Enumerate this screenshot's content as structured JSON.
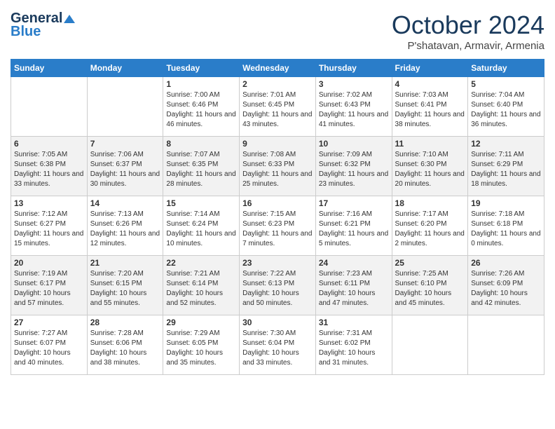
{
  "header": {
    "logo_general": "General",
    "logo_blue": "Blue",
    "title": "October 2024",
    "location": "P'shatavan, Armavir, Armenia"
  },
  "days_of_week": [
    "Sunday",
    "Monday",
    "Tuesday",
    "Wednesday",
    "Thursday",
    "Friday",
    "Saturday"
  ],
  "weeks": [
    [
      {
        "day": "",
        "sunrise": "",
        "sunset": "",
        "daylight": ""
      },
      {
        "day": "",
        "sunrise": "",
        "sunset": "",
        "daylight": ""
      },
      {
        "day": "1",
        "sunrise": "Sunrise: 7:00 AM",
        "sunset": "Sunset: 6:46 PM",
        "daylight": "Daylight: 11 hours and 46 minutes."
      },
      {
        "day": "2",
        "sunrise": "Sunrise: 7:01 AM",
        "sunset": "Sunset: 6:45 PM",
        "daylight": "Daylight: 11 hours and 43 minutes."
      },
      {
        "day": "3",
        "sunrise": "Sunrise: 7:02 AM",
        "sunset": "Sunset: 6:43 PM",
        "daylight": "Daylight: 11 hours and 41 minutes."
      },
      {
        "day": "4",
        "sunrise": "Sunrise: 7:03 AM",
        "sunset": "Sunset: 6:41 PM",
        "daylight": "Daylight: 11 hours and 38 minutes."
      },
      {
        "day": "5",
        "sunrise": "Sunrise: 7:04 AM",
        "sunset": "Sunset: 6:40 PM",
        "daylight": "Daylight: 11 hours and 36 minutes."
      }
    ],
    [
      {
        "day": "6",
        "sunrise": "Sunrise: 7:05 AM",
        "sunset": "Sunset: 6:38 PM",
        "daylight": "Daylight: 11 hours and 33 minutes."
      },
      {
        "day": "7",
        "sunrise": "Sunrise: 7:06 AM",
        "sunset": "Sunset: 6:37 PM",
        "daylight": "Daylight: 11 hours and 30 minutes."
      },
      {
        "day": "8",
        "sunrise": "Sunrise: 7:07 AM",
        "sunset": "Sunset: 6:35 PM",
        "daylight": "Daylight: 11 hours and 28 minutes."
      },
      {
        "day": "9",
        "sunrise": "Sunrise: 7:08 AM",
        "sunset": "Sunset: 6:33 PM",
        "daylight": "Daylight: 11 hours and 25 minutes."
      },
      {
        "day": "10",
        "sunrise": "Sunrise: 7:09 AM",
        "sunset": "Sunset: 6:32 PM",
        "daylight": "Daylight: 11 hours and 23 minutes."
      },
      {
        "day": "11",
        "sunrise": "Sunrise: 7:10 AM",
        "sunset": "Sunset: 6:30 PM",
        "daylight": "Daylight: 11 hours and 20 minutes."
      },
      {
        "day": "12",
        "sunrise": "Sunrise: 7:11 AM",
        "sunset": "Sunset: 6:29 PM",
        "daylight": "Daylight: 11 hours and 18 minutes."
      }
    ],
    [
      {
        "day": "13",
        "sunrise": "Sunrise: 7:12 AM",
        "sunset": "Sunset: 6:27 PM",
        "daylight": "Daylight: 11 hours and 15 minutes."
      },
      {
        "day": "14",
        "sunrise": "Sunrise: 7:13 AM",
        "sunset": "Sunset: 6:26 PM",
        "daylight": "Daylight: 11 hours and 12 minutes."
      },
      {
        "day": "15",
        "sunrise": "Sunrise: 7:14 AM",
        "sunset": "Sunset: 6:24 PM",
        "daylight": "Daylight: 11 hours and 10 minutes."
      },
      {
        "day": "16",
        "sunrise": "Sunrise: 7:15 AM",
        "sunset": "Sunset: 6:23 PM",
        "daylight": "Daylight: 11 hours and 7 minutes."
      },
      {
        "day": "17",
        "sunrise": "Sunrise: 7:16 AM",
        "sunset": "Sunset: 6:21 PM",
        "daylight": "Daylight: 11 hours and 5 minutes."
      },
      {
        "day": "18",
        "sunrise": "Sunrise: 7:17 AM",
        "sunset": "Sunset: 6:20 PM",
        "daylight": "Daylight: 11 hours and 2 minutes."
      },
      {
        "day": "19",
        "sunrise": "Sunrise: 7:18 AM",
        "sunset": "Sunset: 6:18 PM",
        "daylight": "Daylight: 11 hours and 0 minutes."
      }
    ],
    [
      {
        "day": "20",
        "sunrise": "Sunrise: 7:19 AM",
        "sunset": "Sunset: 6:17 PM",
        "daylight": "Daylight: 10 hours and 57 minutes."
      },
      {
        "day": "21",
        "sunrise": "Sunrise: 7:20 AM",
        "sunset": "Sunset: 6:15 PM",
        "daylight": "Daylight: 10 hours and 55 minutes."
      },
      {
        "day": "22",
        "sunrise": "Sunrise: 7:21 AM",
        "sunset": "Sunset: 6:14 PM",
        "daylight": "Daylight: 10 hours and 52 minutes."
      },
      {
        "day": "23",
        "sunrise": "Sunrise: 7:22 AM",
        "sunset": "Sunset: 6:13 PM",
        "daylight": "Daylight: 10 hours and 50 minutes."
      },
      {
        "day": "24",
        "sunrise": "Sunrise: 7:23 AM",
        "sunset": "Sunset: 6:11 PM",
        "daylight": "Daylight: 10 hours and 47 minutes."
      },
      {
        "day": "25",
        "sunrise": "Sunrise: 7:25 AM",
        "sunset": "Sunset: 6:10 PM",
        "daylight": "Daylight: 10 hours and 45 minutes."
      },
      {
        "day": "26",
        "sunrise": "Sunrise: 7:26 AM",
        "sunset": "Sunset: 6:09 PM",
        "daylight": "Daylight: 10 hours and 42 minutes."
      }
    ],
    [
      {
        "day": "27",
        "sunrise": "Sunrise: 7:27 AM",
        "sunset": "Sunset: 6:07 PM",
        "daylight": "Daylight: 10 hours and 40 minutes."
      },
      {
        "day": "28",
        "sunrise": "Sunrise: 7:28 AM",
        "sunset": "Sunset: 6:06 PM",
        "daylight": "Daylight: 10 hours and 38 minutes."
      },
      {
        "day": "29",
        "sunrise": "Sunrise: 7:29 AM",
        "sunset": "Sunset: 6:05 PM",
        "daylight": "Daylight: 10 hours and 35 minutes."
      },
      {
        "day": "30",
        "sunrise": "Sunrise: 7:30 AM",
        "sunset": "Sunset: 6:04 PM",
        "daylight": "Daylight: 10 hours and 33 minutes."
      },
      {
        "day": "31",
        "sunrise": "Sunrise: 7:31 AM",
        "sunset": "Sunset: 6:02 PM",
        "daylight": "Daylight: 10 hours and 31 minutes."
      },
      {
        "day": "",
        "sunrise": "",
        "sunset": "",
        "daylight": ""
      },
      {
        "day": "",
        "sunrise": "",
        "sunset": "",
        "daylight": ""
      }
    ]
  ]
}
